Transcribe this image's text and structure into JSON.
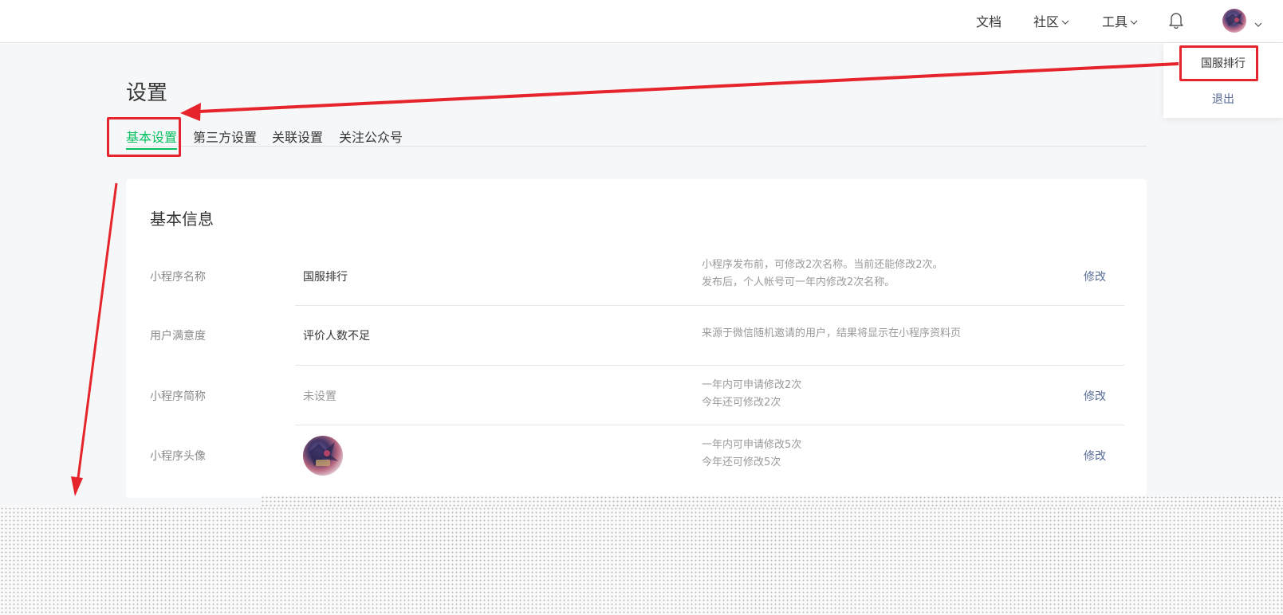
{
  "nav": {
    "docs": "文档",
    "community": "社区",
    "tools": "工具",
    "bell_icon": "bell-icon",
    "avatar_icon": "avatar",
    "chevron_icon": "chevron-down-icon"
  },
  "dropdown": {
    "account_name": "国服排行",
    "logout": "退出"
  },
  "page": {
    "title": "设置"
  },
  "tabs": [
    {
      "label": "基本设置",
      "active": true
    },
    {
      "label": "第三方设置",
      "active": false
    },
    {
      "label": "关联设置",
      "active": false
    },
    {
      "label": "关注公众号",
      "active": false
    }
  ],
  "card": {
    "title": "基本信息",
    "rows": [
      {
        "label": "小程序名称",
        "value": "国服排行",
        "tip_line1": "小程序发布前，可修改2次名称。当前还能修改2次。",
        "tip_line2": "发布后，个人帐号可一年内修改2次名称。",
        "action": "修改"
      },
      {
        "label": "用户满意度",
        "value": "评价人数不足",
        "tip_line1": "来源于微信随机邀请的用户，结果将显示在小程序资料页"
      },
      {
        "label": "小程序简称",
        "value": "未设置",
        "tip_line1": "一年内可申请修改2次",
        "tip_line2": "今年还可修改2次",
        "action": "修改"
      },
      {
        "label": "小程序头像",
        "tip_line1": "一年内可申请修改5次",
        "tip_line2": "今年还可修改5次",
        "action": "修改"
      }
    ]
  },
  "colors": {
    "accent_green": "#07c160",
    "link_blue": "#576b95",
    "annotation_red": "#e5242b"
  }
}
